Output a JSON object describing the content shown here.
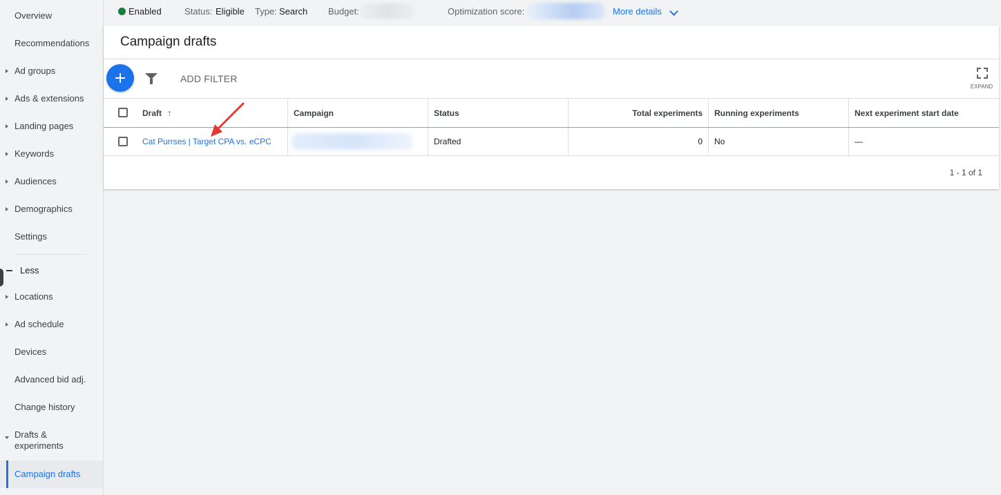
{
  "sidebar": {
    "items": [
      {
        "label": "Overview",
        "caret": ""
      },
      {
        "label": "Recommendations",
        "caret": ""
      },
      {
        "label": "Ad groups",
        "caret": "right"
      },
      {
        "label": "Ads & extensions",
        "caret": "right"
      },
      {
        "label": "Landing pages",
        "caret": "right"
      },
      {
        "label": "Keywords",
        "caret": "right"
      },
      {
        "label": "Audiences",
        "caret": "right"
      },
      {
        "label": "Demographics",
        "caret": "right"
      },
      {
        "label": "Settings",
        "caret": ""
      }
    ],
    "less_label": "Less",
    "more_items": [
      {
        "label": "Locations",
        "caret": "right"
      },
      {
        "label": "Ad schedule",
        "caret": "right"
      },
      {
        "label": "Devices",
        "caret": ""
      },
      {
        "label": "Advanced bid adj.",
        "caret": ""
      },
      {
        "label": "Change history",
        "caret": ""
      },
      {
        "label": "Drafts & experiments",
        "caret": "down"
      },
      {
        "label": "Campaign drafts",
        "caret": "",
        "selected": true
      }
    ]
  },
  "topbar": {
    "enabled": "Enabled",
    "status_label": "Status:",
    "status_value": "Eligible",
    "type_label": "Type:",
    "type_value": "Search",
    "budget_label": "Budget:",
    "optimization_label": "Optimization score:",
    "more_details": "More details"
  },
  "card": {
    "title": "Campaign drafts",
    "add_filter": "ADD FILTER",
    "expand_label": "EXPAND"
  },
  "table": {
    "headers": {
      "draft": "Draft",
      "sort_indicator": "↑",
      "campaign": "Campaign",
      "status": "Status",
      "total": "Total experiments",
      "running": "Running experiments",
      "next": "Next experiment start date"
    },
    "rows": [
      {
        "draft": "Cat Purrses | Target CPA vs. eCPC",
        "campaign": "",
        "status": "Drafted",
        "total": "0",
        "running": "No",
        "next": "—"
      }
    ],
    "pagination": "1 - 1 of 1"
  },
  "colors": {
    "accent": "#1a73e8",
    "enabled_dot": "#188038",
    "annotation_arrow": "#e53935"
  }
}
